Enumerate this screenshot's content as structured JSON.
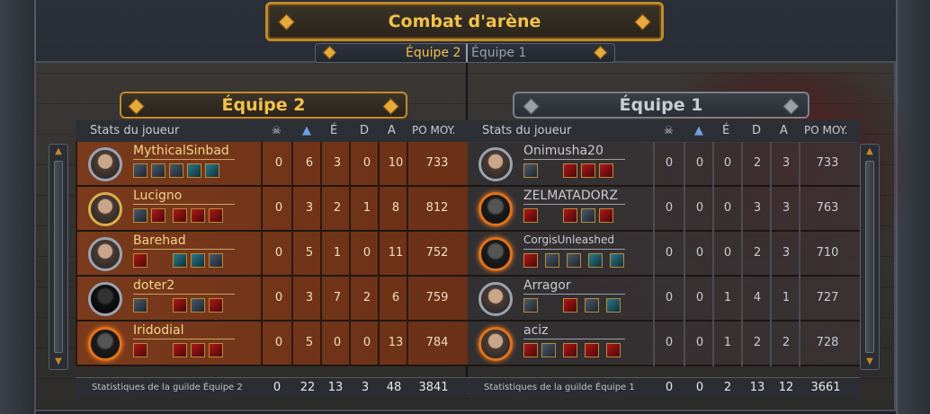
{
  "title": "Combat d'arène",
  "tabs": [
    {
      "label": "Équipe 2",
      "active": true
    },
    {
      "label": "Équipe 1",
      "active": false
    }
  ],
  "columns": {
    "player": "Stats du joueur",
    "kills_icon": "skull-icon",
    "deaths_icon": "shield-icon",
    "e": "É",
    "d": "D",
    "a": "A",
    "po": "PO MOY."
  },
  "left_team": {
    "name": "Équipe 2",
    "players": [
      {
        "name": "MythicalSinbad",
        "c1": "0",
        "c2": "6",
        "e": "3",
        "d": "0",
        "a": "10",
        "po": "733"
      },
      {
        "name": "Lucigno",
        "c1": "0",
        "c2": "3",
        "e": "2",
        "d": "1",
        "a": "8",
        "po": "812"
      },
      {
        "name": "Barehad",
        "c1": "0",
        "c2": "5",
        "e": "1",
        "d": "0",
        "a": "11",
        "po": "752"
      },
      {
        "name": "doter2",
        "c1": "0",
        "c2": "3",
        "e": "7",
        "d": "2",
        "a": "6",
        "po": "759"
      },
      {
        "name": "Iridodial",
        "c1": "0",
        "c2": "5",
        "e": "0",
        "d": "0",
        "a": "13",
        "po": "784"
      }
    ],
    "footer": {
      "label": "Statistiques de la guilde Équipe 2",
      "c1": "0",
      "c2": "22",
      "e": "13",
      "d": "3",
      "a": "48",
      "po": "3841"
    }
  },
  "right_team": {
    "name": "Équipe 1",
    "players": [
      {
        "name": "Onimusha20",
        "c1": "0",
        "c2": "0",
        "e": "0",
        "d": "2",
        "a": "3",
        "po": "733"
      },
      {
        "name": "ZELMATADORZ",
        "c1": "0",
        "c2": "0",
        "e": "0",
        "d": "3",
        "a": "3",
        "po": "763"
      },
      {
        "name": "CorgisUnleashed",
        "c1": "0",
        "c2": "0",
        "e": "0",
        "d": "2",
        "a": "3",
        "po": "710"
      },
      {
        "name": "Arragor",
        "c1": "0",
        "c2": "0",
        "e": "1",
        "d": "4",
        "a": "1",
        "po": "727"
      },
      {
        "name": "aciz",
        "c1": "0",
        "c2": "0",
        "e": "1",
        "d": "2",
        "a": "2",
        "po": "728"
      }
    ],
    "footer": {
      "label": "Statistiques de la guilde Équipe 1",
      "c1": "0",
      "c2": "0",
      "e": "2",
      "d": "13",
      "a": "12",
      "po": "3661"
    }
  },
  "colors": {
    "gold": "#f2c14a",
    "left_row": "#7a3a1c",
    "frame": "#2b2f37"
  }
}
